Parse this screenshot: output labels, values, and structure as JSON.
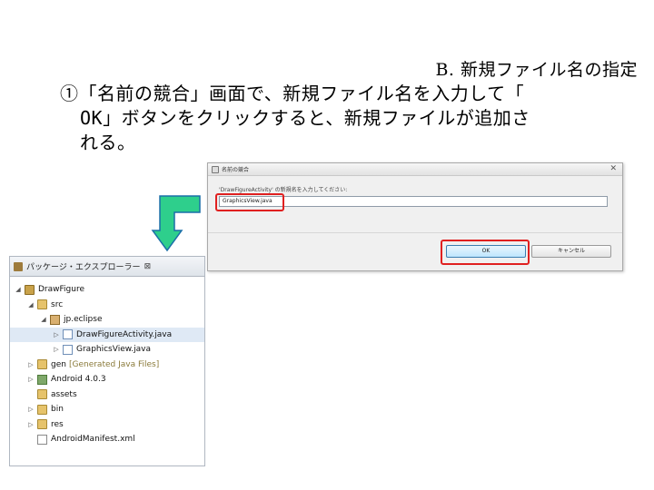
{
  "slide": {
    "title": "B. 新規ファイル名の指定",
    "body_line1": "①「名前の競合」画面で、新規ファイル名を入力して「",
    "body_line2": "OK」ボタンをクリックすると、新規ファイルが追加さ",
    "body_line3": "れる。"
  },
  "dialog": {
    "title": "名前の競合",
    "close_label": "✕",
    "message": "'DrawFigureActivity' の新規名を入力してください:",
    "input_value": "GraphicsView.java",
    "ok_label": "OK",
    "cancel_label": "キャンセル"
  },
  "explorer": {
    "header_title": "パッケージ・エクスプローラー",
    "close_label": "⊠",
    "items": [
      {
        "label": "DrawFigure",
        "suffix": "",
        "icon": "project-icon"
      },
      {
        "label": "src",
        "suffix": "",
        "icon": "folder-icon"
      },
      {
        "label": "jp.eclipse",
        "suffix": "",
        "icon": "package-icon"
      },
      {
        "label": "DrawFigureActivity.java",
        "suffix": "",
        "icon": "java-file-icon"
      },
      {
        "label": "GraphicsView.java",
        "suffix": "",
        "icon": "java-file-icon"
      },
      {
        "label": "gen",
        "suffix": "[Generated Java Files]",
        "icon": "folder-icon"
      },
      {
        "label": "Android 4.0.3",
        "suffix": "",
        "icon": "library-icon"
      },
      {
        "label": "assets",
        "suffix": "",
        "icon": "folder-icon"
      },
      {
        "label": "bin",
        "suffix": "",
        "icon": "folder-icon"
      },
      {
        "label": "res",
        "suffix": "",
        "icon": "folder-icon"
      },
      {
        "label": "AndroidManifest.xml",
        "suffix": "",
        "icon": "xml-file-icon"
      }
    ]
  },
  "colors": {
    "highlight": "#e02020",
    "arrow_fill": "#2ecf8c",
    "arrow_stroke": "#1a6fa8"
  }
}
